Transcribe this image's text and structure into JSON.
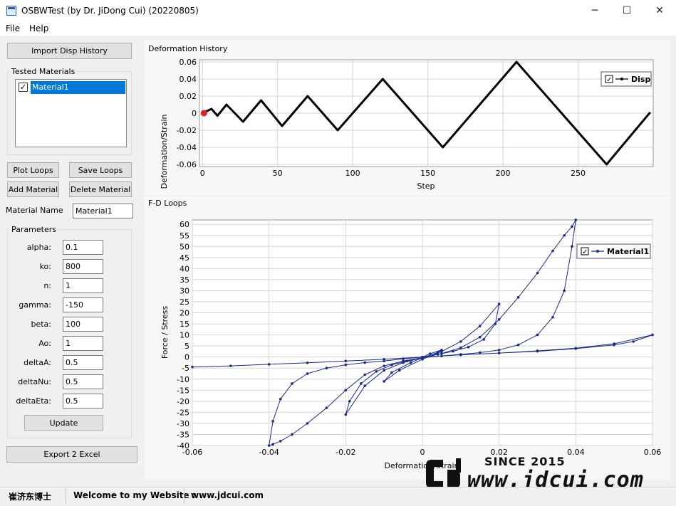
{
  "window": {
    "title": "OSBWTest (by Dr. JiDong Cui) (20220805)",
    "minimize_glyph": "─",
    "maximize_glyph": "☐",
    "close_glyph": "✕"
  },
  "menu": [
    "File",
    "Help"
  ],
  "left_panel": {
    "import_button": "Import Disp History",
    "tested_materials_label": "Tested Materials",
    "materials": [
      {
        "name": "Material1",
        "checked": true,
        "selected": true
      }
    ],
    "plot_loops_button": "Plot Loops",
    "save_loops_button": "Save Loops",
    "add_material_button": "Add Material",
    "delete_material_button": "Delete Material",
    "material_name_label": "Material Name",
    "material_name_value": "Material1",
    "parameters_label": "Parameters",
    "parameters": [
      {
        "label": "alpha:",
        "value": "0.1"
      },
      {
        "label": "ko:",
        "value": "800"
      },
      {
        "label": "n:",
        "value": "1"
      },
      {
        "label": "gamma:",
        "value": "-150"
      },
      {
        "label": "beta:",
        "value": "100"
      },
      {
        "label": "Ao:",
        "value": "1"
      },
      {
        "label": "deltaA:",
        "value": "0.5"
      },
      {
        "label": "deltaNu:",
        "value": "0.5"
      },
      {
        "label": "deltaEta:",
        "value": "0.5"
      }
    ],
    "update_button": "Update",
    "export_button": "Export 2 Excel"
  },
  "deformation_panel": {
    "title": "Deformation History"
  },
  "fd_panel": {
    "title": "F-D Loops"
  },
  "chart_data": [
    {
      "type": "line",
      "title": "",
      "xlabel": "Step",
      "ylabel": "Deformation/Strain",
      "xlim": [
        -2,
        300
      ],
      "ylim": [
        -0.0625,
        0.0625
      ],
      "xticks": [
        0,
        50,
        100,
        150,
        200,
        250
      ],
      "yticks": [
        0.06,
        0.04,
        0.02,
        0,
        -0.02,
        -0.04,
        -0.06
      ],
      "ytick_labels": [
        "0.06",
        "0.04",
        "0.02",
        "0",
        "-0.02",
        "-0.04",
        "-0.06"
      ],
      "grid": true,
      "legend_position": "top-right",
      "series": [
        {
          "name": "Disp",
          "color": "#000000",
          "x": [
            0,
            6,
            10,
            16,
            27,
            39,
            53,
            70,
            90,
            120,
            160,
            209,
            269,
            298
          ],
          "y": [
            0,
            0.005,
            -0.003,
            0.01,
            -0.01,
            0.015,
            -0.015,
            0.02,
            -0.02,
            0.04,
            -0.04,
            0.06,
            -0.06,
            0.001
          ]
        }
      ],
      "marker": {
        "x": 1,
        "y": 0,
        "color": "#e02020"
      }
    },
    {
      "type": "line",
      "title": "",
      "xlabel": "Deformation/Strain",
      "ylabel": "Force / Stress",
      "xlim": [
        -0.06,
        0.06
      ],
      "ylim": [
        -40,
        62
      ],
      "xticks": [
        -0.06,
        -0.04,
        -0.02,
        0,
        0.02,
        0.04,
        0.06
      ],
      "xtick_labels": [
        "-0.06",
        "-0.04",
        "-0.02",
        "0",
        "0.02",
        "0.04",
        "0.06"
      ],
      "yticks": [
        60,
        55,
        50,
        45,
        40,
        35,
        30,
        25,
        20,
        15,
        10,
        5,
        0,
        -5,
        -10,
        -15,
        -20,
        -25,
        -30,
        -35,
        -40
      ],
      "grid": true,
      "legend_position": "top-right",
      "series": [
        {
          "name": "Material1",
          "color": "#1a2a8c",
          "x": [
            0,
            0.002,
            0.005,
            0.004,
            0,
            -0.003,
            -0.008,
            -0.01,
            -0.006,
            0,
            0.005,
            0.01,
            0.015,
            0.02,
            0.019,
            0.016,
            0.012,
            0.008,
            0.004,
            0,
            -0.005,
            -0.01,
            -0.015,
            -0.02,
            -0.019,
            -0.016,
            -0.012,
            -0.008,
            -0.004,
            0,
            0.005,
            0.01,
            0.015,
            0.02,
            0.025,
            0.03,
            0.034,
            0.037,
            0.039,
            0.04,
            0.039,
            0.037,
            0.034,
            0.03,
            0.025,
            0.02,
            0.015,
            0.01,
            0.005,
            0,
            -0.005,
            -0.01,
            -0.015,
            -0.02,
            -0.025,
            -0.03,
            -0.034,
            -0.037,
            -0.039,
            -0.04,
            -0.039,
            -0.037,
            -0.034,
            -0.03,
            -0.025,
            -0.02,
            -0.015,
            -0.01,
            -0.005,
            0,
            0.01,
            0.02,
            0.03,
            0.04,
            0.05,
            0.06,
            0.055,
            0.05,
            0.04,
            0.03,
            0.02,
            0.01,
            0,
            -0.01,
            -0.02,
            -0.03,
            -0.04,
            -0.05,
            -0.06
          ],
          "y": [
            0,
            1.5,
            3.2,
            2.1,
            -0.3,
            -2.5,
            -7,
            -11,
            -6,
            -1,
            2.5,
            7,
            14,
            24,
            15,
            8,
            4.5,
            2.6,
            1.2,
            -0.3,
            -2.5,
            -6,
            -13,
            -26,
            -20,
            -12,
            -6.5,
            -3.5,
            -1.8,
            -0.3,
            1.6,
            4.2,
            9,
            17,
            27,
            38,
            48,
            55,
            59,
            62,
            50,
            30,
            18,
            10,
            5.5,
            3.2,
            2,
            1.2,
            0.5,
            -0.3,
            -1.8,
            -4,
            -8,
            -15,
            -23,
            -30,
            -35,
            -38,
            -39.5,
            -40,
            -29,
            -19,
            -12,
            -7.5,
            -5,
            -3.5,
            -2.5,
            -1.8,
            -0.8,
            0,
            1,
            1.8,
            2.8,
            4,
            6,
            10,
            7,
            5.5,
            3.8,
            2.6,
            1.8,
            1,
            0,
            -1,
            -1.8,
            -2.6,
            -3.3,
            -4,
            -4.5
          ]
        }
      ]
    }
  ],
  "watermark": {
    "since": "SINCE 2015",
    "url": "www.jdcui.com"
  },
  "status_bar": {
    "author": "崔济东博士",
    "welcome": "Welcome to my Website :",
    "website": "www.jdcui.com"
  }
}
